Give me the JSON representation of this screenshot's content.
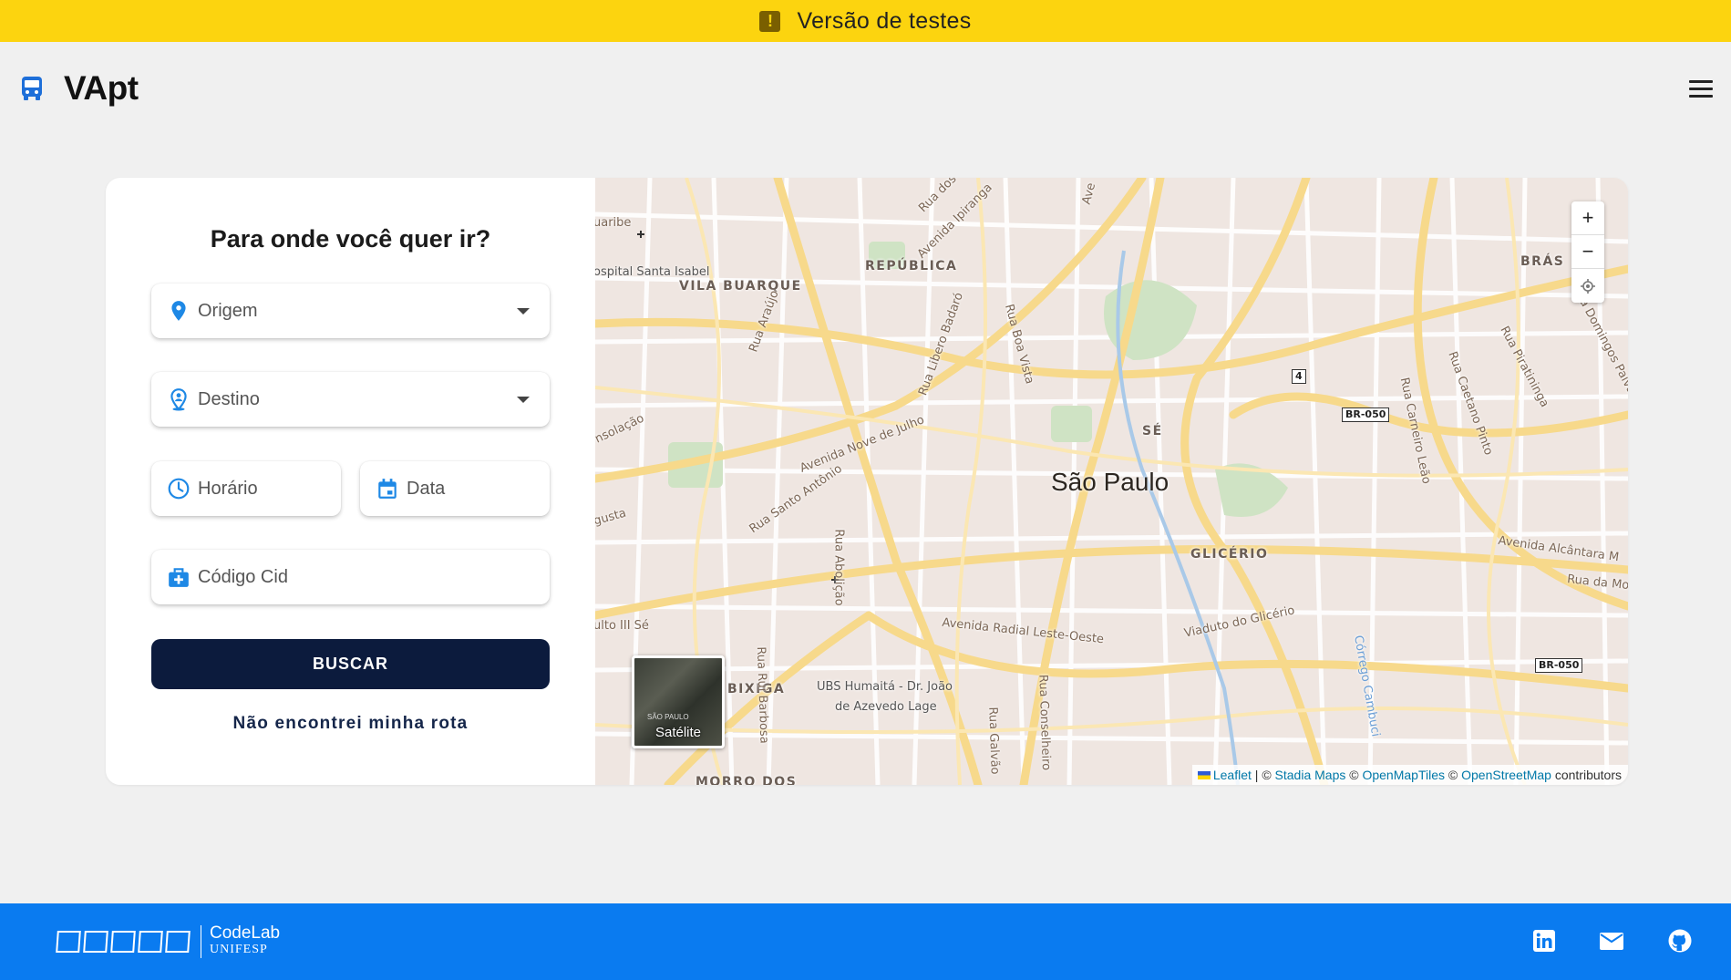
{
  "banner": {
    "icon": "warning-icon",
    "text": "Versão de testes",
    "bg_color": "#fcd40f"
  },
  "header": {
    "brand_icon": "bus-icon",
    "brand_name": "VApt",
    "menu_icon": "hamburger-menu-icon"
  },
  "form": {
    "title": "Para onde você quer ir?",
    "origin": {
      "icon": "location-pin-icon",
      "placeholder": "Origem"
    },
    "destination": {
      "icon": "location-person-icon",
      "placeholder": "Destino"
    },
    "time": {
      "icon": "clock-icon",
      "placeholder": "Horário"
    },
    "date": {
      "icon": "calendar-icon",
      "placeholder": "Data"
    },
    "cid": {
      "icon": "medical-bag-icon",
      "placeholder": "Código Cid"
    },
    "search_button": "BUSCAR",
    "no_route_link": "Não encontrei minha rota",
    "accent_color": "#1e88e5",
    "button_color": "#0c1b3d"
  },
  "map": {
    "city": "São Paulo",
    "districts": [
      "REPÚBLICA",
      "VILA BUARQUE",
      "BRÁS",
      "SÉ",
      "GLICÉRIO",
      "BIXIGA",
      "MORRO DOS"
    ],
    "streets": [
      "Avenida Ipiranga",
      "Rua dos",
      "Rua Araújo",
      "Rua Libero Badaró",
      "Rua Boa Vista",
      "Avenida Nove de Julho",
      "Rua Santo Antônio",
      "Rua Abolição",
      "Avenida Radial Leste-Oeste",
      "Viaduto do Glicério",
      "Rua Rui Barbosa",
      "Rua Galvão",
      "Rua Conselheiro",
      "Avenida Alcântara M",
      "Rua da Moo",
      "Rua Piratininga",
      "Rua Caetano Pinto",
      "Rua Carneiro Leão",
      "Rua Domingos Paiva",
      "Córrego Cambuci",
      "nsolação",
      "gusta",
      "uaribe",
      "Ave",
      "ulto III Sé"
    ],
    "pois": [
      "ospital Santa Isabel",
      "UBS Humaitá - Dr. João",
      "de Azevedo Lage"
    ],
    "shields": [
      "BR-050",
      "BR-050",
      "4"
    ],
    "zoom_in": "+",
    "zoom_out": "−",
    "locate_icon": "locate-icon",
    "satellite_label": "Satélite",
    "satellite_tiny": "SÃO PAULO",
    "attribution": {
      "leaflet": "Leaflet",
      "sep1": " | © ",
      "stadia": "Stadia Maps",
      "sep2": " © ",
      "omt": "OpenMapTiles",
      "sep3": " © ",
      "osm": "OpenStreetMap",
      "suffix": " contributors"
    }
  },
  "footer": {
    "logo_line1": "CodeLab",
    "logo_line2": "UNIFESP",
    "bg_color": "#0a7bf0",
    "social": [
      "linkedin-icon",
      "mail-icon",
      "github-icon"
    ]
  }
}
